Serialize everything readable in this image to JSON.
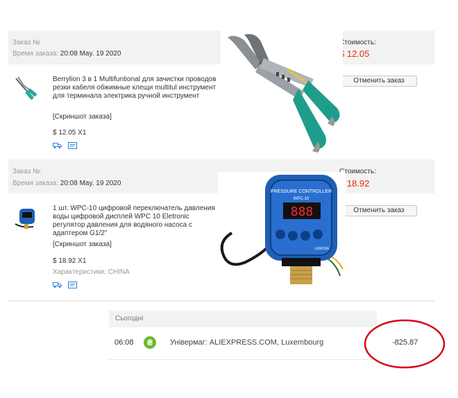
{
  "orders": [
    {
      "order_no_label": "Заказ №",
      "order_time_label": "Время заказа:",
      "order_time_value": "20:08 May. 19 2020",
      "cost_label": "Стоимость:",
      "cost_value": "$ 12.05",
      "title": "Berrylion 3 в 1 Multifuntional для зачистки проводов резки кабеля обжимные клещи multitul инструмент для терминала электрика ручной инструмент",
      "snapshot": "[Скриншот заказа]",
      "price_qty": "$ 12.05 X1",
      "cancel_label": "Отменить заказ",
      "photo_icon": "crimping-pliers-image"
    },
    {
      "order_no_label": "Заказ №:",
      "order_time_label": "Время заказа:",
      "order_time_value": "20:08 May. 19 2020",
      "cost_label": "Стоимость:",
      "cost_value": "$ 18.92",
      "title": "1 шт. WPC-10 цифровой переключатель давления воды цифровой дисплей WPC 10 Eletronic регулятор давления для водяного насоса с адаптером G1/2\"",
      "snapshot": "[Скриншот заказа]",
      "price_qty": "$ 18.92 X1",
      "props": "Характеристики: CHINA",
      "cancel_label": "Отменить заказ",
      "photo_icon": "pressure-controller-image",
      "device_brand_text": "PRESSURE CONTROLLER",
      "device_model_text": "WPC-10",
      "device_display": "888",
      "device_maker": "LEMODE"
    }
  ],
  "bank": {
    "section_label": "Сьогодні",
    "time": "06:08",
    "merchant_icon_letter": "₴",
    "merchant": "Універмаг: ALIEXPRESS.COM, Luxembourg",
    "amount": "-825.87"
  },
  "colors": {
    "price_red": "#e62e04",
    "annotation_red": "#d9001b",
    "merchant_green": "#6dbb2d"
  }
}
